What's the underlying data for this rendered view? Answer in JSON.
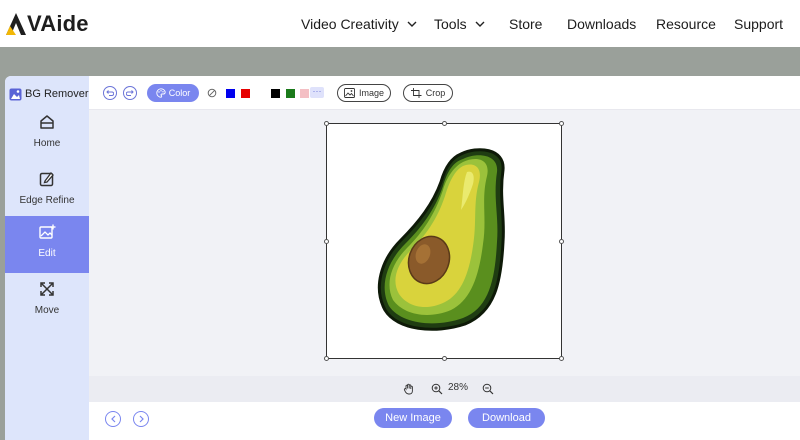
{
  "header": {
    "logo_text": "VAide",
    "nav": [
      {
        "label": "Video Creativity",
        "has_dropdown": true
      },
      {
        "label": "Tools",
        "has_dropdown": true
      },
      {
        "label": "Store",
        "has_dropdown": false
      },
      {
        "label": "Downloads",
        "has_dropdown": false
      },
      {
        "label": "Resource",
        "has_dropdown": false
      },
      {
        "label": "Support",
        "has_dropdown": false
      }
    ]
  },
  "sidebar": {
    "brand": "BG Remover",
    "items": [
      {
        "label": "Home",
        "icon": "home-icon",
        "active": false
      },
      {
        "label": "Edge Refine",
        "icon": "edge-refine-icon",
        "active": false
      },
      {
        "label": "Edit",
        "icon": "edit-image-icon",
        "active": true
      },
      {
        "label": "Move",
        "icon": "move-icon",
        "active": false
      }
    ]
  },
  "toolbar": {
    "color_label": "Color",
    "swatches": [
      "#0000ee",
      "#e60000",
      "#ffffff",
      "#ffffff",
      "#000000",
      "#1a7a1a",
      "#f4bfc4"
    ],
    "image_label": "Image",
    "crop_label": "Crop"
  },
  "canvas": {
    "zoom": "28%"
  },
  "footer": {
    "new_image_label": "New Image",
    "download_label": "Download"
  },
  "colors": {
    "accent": "#7a86ef",
    "sidebar_bg": "#dde5fb",
    "canvas_bg": "#f1f2f6"
  }
}
